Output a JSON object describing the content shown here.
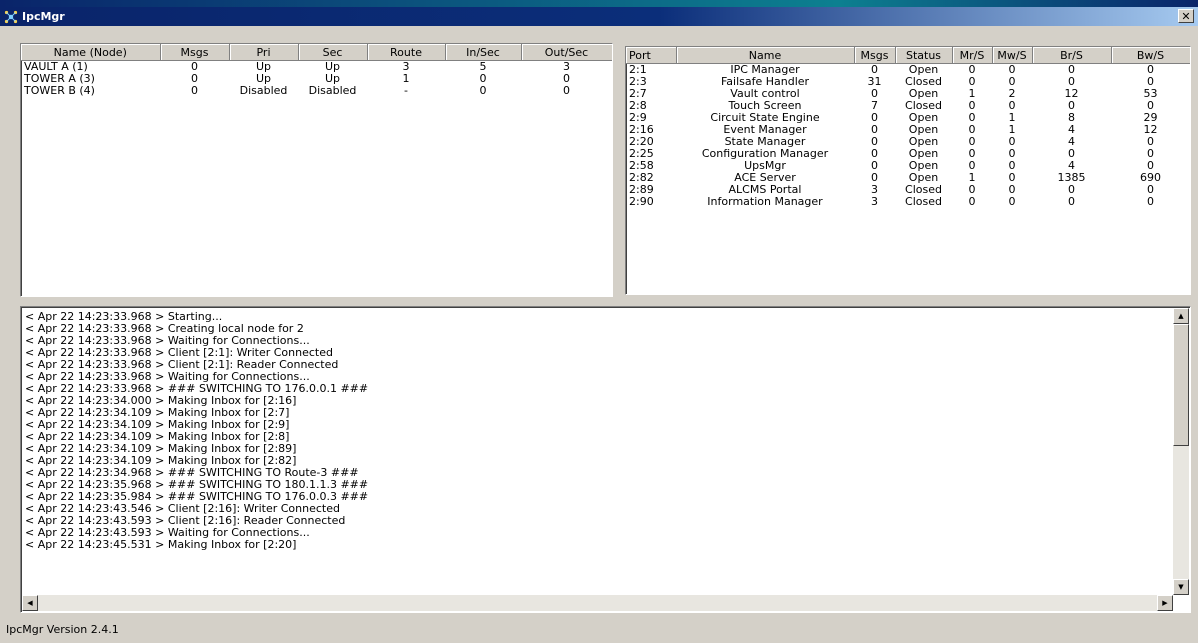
{
  "window": {
    "title": "IpcMgr"
  },
  "nodes": {
    "columns": [
      "Name (Node)",
      "Msgs",
      "Pri",
      "Sec",
      "Route",
      "In/Sec",
      "Out/Sec"
    ],
    "rows": [
      [
        "VAULT A (1)",
        "0",
        "Up",
        "Up",
        "3",
        "5",
        "3"
      ],
      [
        "TOWER A (3)",
        "0",
        "Up",
        "Up",
        "1",
        "0",
        "0"
      ],
      [
        "TOWER B (4)",
        "0",
        "Disabled",
        "Disabled",
        "-",
        "0",
        "0"
      ]
    ]
  },
  "ports": {
    "columns": [
      "Port",
      "Name",
      "Msgs",
      "Status",
      "Mr/S",
      "Mw/S",
      "Br/S",
      "Bw/S"
    ],
    "rows": [
      [
        "2:1",
        "IPC Manager",
        "0",
        "Open",
        "0",
        "0",
        "0",
        "0"
      ],
      [
        "2:3",
        "Failsafe Handler",
        "31",
        "Closed",
        "0",
        "0",
        "0",
        "0"
      ],
      [
        "2:7",
        "Vault control",
        "0",
        "Open",
        "1",
        "2",
        "12",
        "53"
      ],
      [
        "2:8",
        "Touch Screen",
        "7",
        "Closed",
        "0",
        "0",
        "0",
        "0"
      ],
      [
        "2:9",
        "Circuit State Engine",
        "0",
        "Open",
        "0",
        "1",
        "8",
        "29"
      ],
      [
        "2:16",
        "Event Manager",
        "0",
        "Open",
        "0",
        "1",
        "4",
        "12"
      ],
      [
        "2:20",
        "State Manager",
        "0",
        "Open",
        "0",
        "0",
        "4",
        "0"
      ],
      [
        "2:25",
        "Configuration Manager",
        "0",
        "Open",
        "0",
        "0",
        "0",
        "0"
      ],
      [
        "2:58",
        "UpsMgr",
        "0",
        "Open",
        "0",
        "0",
        "4",
        "0"
      ],
      [
        "2:82",
        "ACE Server",
        "0",
        "Open",
        "1",
        "0",
        "1385",
        "690"
      ],
      [
        "2:89",
        "ALCMS Portal",
        "3",
        "Closed",
        "0",
        "0",
        "0",
        "0"
      ],
      [
        "2:90",
        "Information Manager",
        "3",
        "Closed",
        "0",
        "0",
        "0",
        "0"
      ]
    ]
  },
  "log": {
    "lines": [
      [
        "< Apr 22 14:23:33.968 >",
        "Starting..."
      ],
      [
        "< Apr 22 14:23:33.968 >",
        "Creating local node for 2"
      ],
      [
        "< Apr 22 14:23:33.968 >",
        "Waiting for Connections..."
      ],
      [
        "< Apr 22 14:23:33.968 >",
        "Client [2:1]: Writer Connected"
      ],
      [
        "< Apr 22 14:23:33.968 >",
        "Client [2:1]: Reader Connected"
      ],
      [
        "< Apr 22 14:23:33.968 >",
        "Waiting for Connections..."
      ],
      [
        "< Apr 22 14:23:33.968 >",
        "### SWITCHING TO 176.0.0.1 ###"
      ],
      [
        "< Apr 22 14:23:34.000 >",
        "Making Inbox for [2:16]"
      ],
      [
        "< Apr 22 14:23:34.109 >",
        "Making Inbox for [2:7]"
      ],
      [
        "< Apr 22 14:23:34.109 >",
        "Making Inbox for [2:9]"
      ],
      [
        "< Apr 22 14:23:34.109 >",
        "Making Inbox for [2:8]"
      ],
      [
        "< Apr 22 14:23:34.109 >",
        "Making Inbox for [2:89]"
      ],
      [
        "< Apr 22 14:23:34.109 >",
        "Making Inbox for [2:82]"
      ],
      [
        "< Apr 22 14:23:34.968 >",
        "### SWITCHING TO Route-3 ###"
      ],
      [
        "< Apr 22 14:23:35.968 >",
        "### SWITCHING TO 180.1.1.3 ###"
      ],
      [
        "< Apr 22 14:23:35.984 >",
        "### SWITCHING TO 176.0.0.3 ###"
      ],
      [
        "< Apr 22 14:23:43.546 >",
        "Client [2:16]: Writer Connected"
      ],
      [
        "< Apr 22 14:23:43.593 >",
        "Client [2:16]: Reader Connected"
      ],
      [
        "< Apr 22 14:23:43.593 >",
        "Waiting for Connections..."
      ],
      [
        "< Apr 22 14:23:45.531 >",
        "Making Inbox for [2:20]"
      ]
    ]
  },
  "status": {
    "version": "IpcMgr Version 2.4.1"
  },
  "icons": {
    "app": "network-icon",
    "close": "close-icon"
  }
}
